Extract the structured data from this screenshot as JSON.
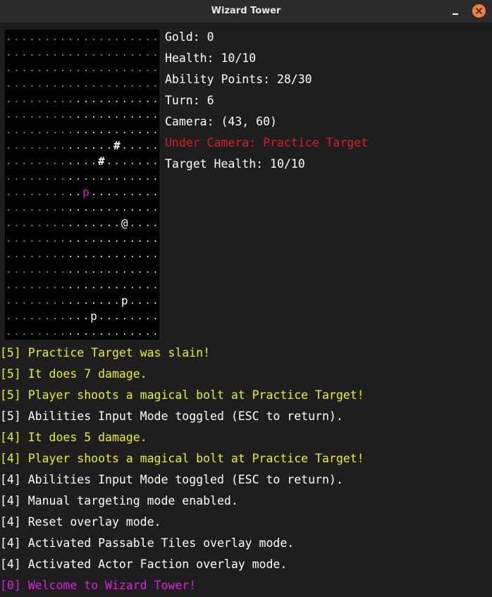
{
  "window": {
    "title": "Wizard Tower"
  },
  "colors": {
    "background": "#1e1e1e",
    "map_background": "#000000",
    "highlight_red": "#dd1e1e",
    "log_yellow": "#eeee22",
    "log_magenta": "#dd22dd",
    "close_button": "#f0803c"
  },
  "map": {
    "rows": [
      "....................",
      "....................",
      "....................",
      "....................",
      ".........  ... .......",
      "........ ....  .......",
      "....... .........  ...",
      "........  ..#.....",
      "........#.......",
      "....................",
      "..........p.........",
      "....................",
      "................@....",
      "....................",
      "....................",
      "....................",
      "....................",
      "................p....",
      "...........p........",
      "...................."
    ],
    "grid": [
      "....................",
      "....................",
      "....................",
      "....................",
      "....................",
      "....................",
      "....................",
      "..............#.....",
      "............#.......",
      "....................",
      "..........p.........",
      "....................",
      "...............@....",
      "....................",
      "....................",
      "....................",
      "....................",
      "...............p....",
      "...........p........",
      "...................."
    ],
    "highlighted_enemy": [
      10,
      10
    ]
  },
  "stats": {
    "gold": "Gold: 0",
    "health": "Health: 10/10",
    "ability_points": "Ability Points: 28/30",
    "turn": "Turn: 6",
    "camera": "Camera: (43, 60)",
    "under_camera": "Under Camera: Practice Target",
    "target_health": "Target Health: 10/10"
  },
  "log": [
    {
      "text": "[5] Practice Target was slain!",
      "color": "yellow"
    },
    {
      "text": "[5] It does 7 damage.",
      "color": "yellow"
    },
    {
      "text": "[5] Player shoots a magical bolt at Practice Target!",
      "color": "yellow"
    },
    {
      "text": "[5] Abilities Input Mode toggled (ESC to return).",
      "color": "white"
    },
    {
      "text": "[4] It does 5 damage.",
      "color": "yellow"
    },
    {
      "text": "[4] Player shoots a magical bolt at Practice Target!",
      "color": "yellow"
    },
    {
      "text": "[4] Abilities Input Mode toggled (ESC to return).",
      "color": "white"
    },
    {
      "text": "[4] Manual targeting mode enabled.",
      "color": "white"
    },
    {
      "text": "[4] Reset overlay mode.",
      "color": "white"
    },
    {
      "text": "[4] Activated Passable Tiles overlay mode.",
      "color": "white"
    },
    {
      "text": "[4] Activated Actor Faction overlay mode.",
      "color": "white"
    },
    {
      "text": "[0] Welcome to Wizard Tower!",
      "color": "magenta"
    }
  ]
}
